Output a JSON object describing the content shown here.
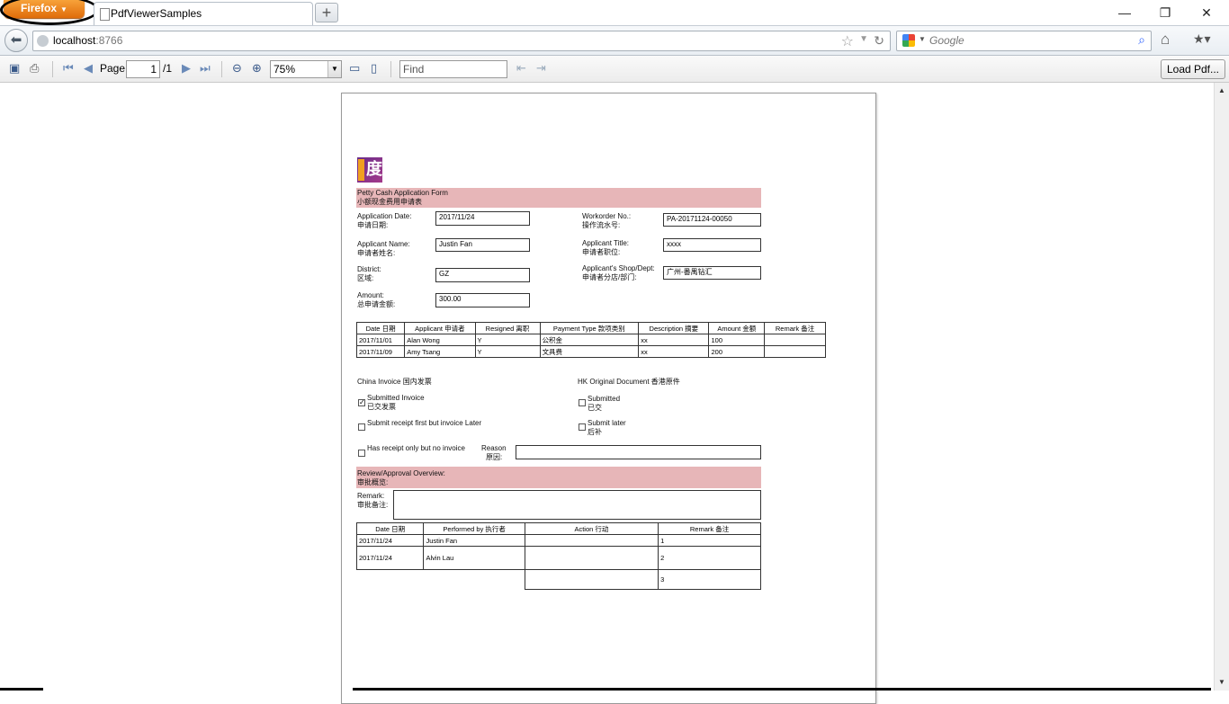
{
  "browser": {
    "menu_button": "Firefox",
    "tab_title": "PdfViewerSamples",
    "new_tab": "+",
    "url_host": "localhost",
    "url_port": ":8766",
    "search_placeholder": "Google",
    "window_buttons": {
      "minimize": "—",
      "restore": "❐",
      "close": "✕"
    }
  },
  "toolbar": {
    "page_label": "Page",
    "page_value": "1",
    "page_total": "/1",
    "zoom": "75%",
    "find_placeholder": "Find",
    "load_button": "Load Pdf..."
  },
  "form": {
    "title_en": "Petty Cash Application Form",
    "title_cn": "小额现金费用申请表",
    "fields": {
      "app_date_label": "Application Date:",
      "app_date_label_cn": "申请日期:",
      "app_date": "2017/11/24",
      "workorder_label": "Workorder No.:",
      "workorder_label_cn": "操作流水号:",
      "workorder": "PA-20171124-00050",
      "applicant_label": "Applicant Name:",
      "applicant_label_cn": "申请者姓名:",
      "applicant": "Justin Fan",
      "title_label": "Applicant Title:",
      "title_label_cn": "申请者职位:",
      "title_value": "xxxx",
      "district_label": "District:",
      "district_label_cn": "区域:",
      "district": "GZ",
      "shop_label": "Applicant's Shop/Dept:",
      "shop_label_cn": "申请者分店/部门:",
      "shop": "广州-番禺钻汇",
      "amount_label": "Amount:",
      "amount_label_cn": "总申请金额:",
      "amount": "300.00"
    },
    "items_table": {
      "headers": [
        "Date 日期",
        "Applicant 申请者",
        "Resigned 离职",
        "Payment Type 款项类别",
        "Description 摘要",
        "Amount 金额",
        "Remark 备注"
      ],
      "rows": [
        [
          "2017/11/01",
          "Alan Wong",
          "Y",
          "公积金",
          "xx",
          "100",
          ""
        ],
        [
          "2017/11/09",
          "Amy Tsang",
          "Y",
          "文具费",
          "xx",
          "200",
          ""
        ]
      ]
    },
    "china_invoice": "China Invoice 国内发票",
    "hk_doc": "HK Original Document 香港原件",
    "cb_submitted_invoice": "Submitted Invoice",
    "cb_submitted_invoice_cn": "已交发票",
    "cb_submit_later_invoice": "Submit receipt first but invoice Later",
    "cb_receipt_only": "Has receipt only but no invoice",
    "reason_label": "Reason",
    "reason_label_cn": "原因:",
    "cb_submitted": "Submitted",
    "cb_submitted_cn": "已交",
    "cb_submit_later": "Submit later",
    "cb_submit_later_cn": "后补",
    "review_title": "Review/Approval Overview:",
    "review_title_cn": "审批概览:",
    "remark_label": "Remark:",
    "remark_label_cn": "审批备注:",
    "approval_table": {
      "headers": [
        "Date 日期",
        "Performed by 执行者",
        "Action 行动",
        "Remark 备注"
      ],
      "rows": [
        [
          "2017/11/24",
          "Justin Fan",
          "",
          "1"
        ],
        [
          "2017/11/24",
          "Alvin Lau",
          "",
          "2"
        ],
        [
          "",
          "",
          "",
          "3"
        ]
      ]
    }
  }
}
